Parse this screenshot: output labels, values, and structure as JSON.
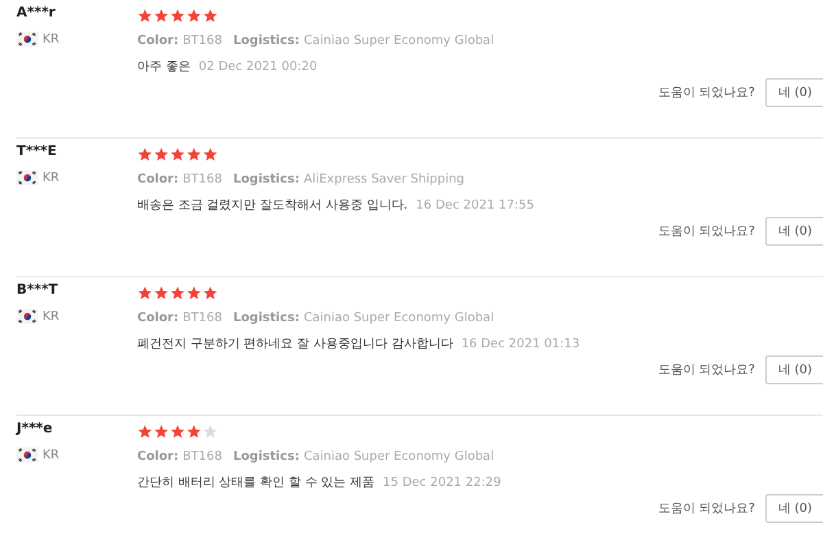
{
  "reviews": [
    {
      "name": "A***r",
      "country": "KR",
      "stars": 5,
      "color_label": "Color:",
      "variant": "BT168",
      "logistics_label": "Logistics:",
      "logistics": "Cainiao Super Economy Global",
      "comment": "아주 좋은",
      "date": "02 Dec 2021 00:20",
      "helpful": "도움이 되었나요?",
      "yes": "네 (0)"
    },
    {
      "name": "T***E",
      "country": "KR",
      "stars": 5,
      "color_label": "Color:",
      "variant": "BT168",
      "logistics_label": "Logistics:",
      "logistics": "AliExpress Saver Shipping",
      "comment": "배송은 조금 걸렸지만 잘도착해서 사용중 입니다.",
      "date": "16 Dec 2021 17:55",
      "helpful": "도움이 되었나요?",
      "yes": "네 (0)"
    },
    {
      "name": "B***T",
      "country": "KR",
      "stars": 5,
      "color_label": "Color:",
      "variant": "BT168",
      "logistics_label": "Logistics:",
      "logistics": "Cainiao Super Economy Global",
      "comment": "폐건전지 구분하기 편하네요 잘 사용중입니다 감사합니다",
      "date": "16 Dec 2021 01:13",
      "helpful": "도움이 되었나요?",
      "yes": "네 (0)"
    },
    {
      "name": "J***e",
      "country": "KR",
      "stars": 4,
      "color_label": "Color:",
      "variant": "BT168",
      "logistics_label": "Logistics:",
      "logistics": "Cainiao Super Economy Global",
      "comment": "간단히 배터리 상태를 확인 할 수 있는 제품",
      "date": "15 Dec 2021 22:29",
      "helpful": "도움이 되었나요?",
      "yes": "네 (0)"
    }
  ]
}
